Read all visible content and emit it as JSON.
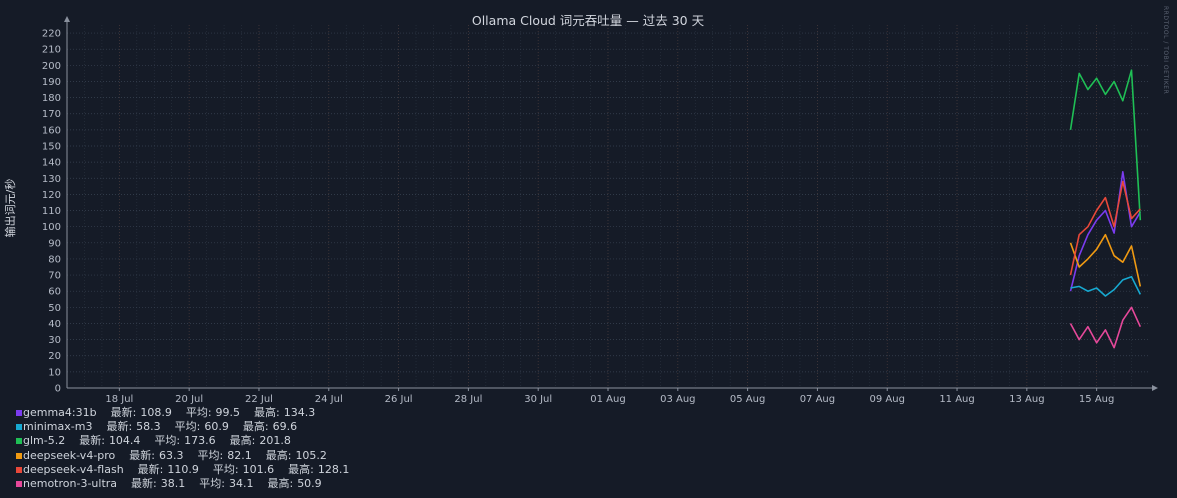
{
  "chart_data": {
    "type": "line",
    "title": "Ollama Cloud 词元吞吐量 — 过去 30 天",
    "ylabel": "输出词元/秒",
    "xlabel": "",
    "ylim": [
      0,
      225
    ],
    "yticks": [
      0,
      10,
      20,
      30,
      40,
      50,
      60,
      70,
      80,
      90,
      100,
      110,
      120,
      130,
      140,
      150,
      160,
      170,
      180,
      190,
      200,
      210,
      220
    ],
    "xlim": [
      "2025-07-16T12:00",
      "2025-08-16T12:00"
    ],
    "xticks": [
      {
        "date": "2025-07-18",
        "label": "18 Jul"
      },
      {
        "date": "2025-07-20",
        "label": "20 Jul"
      },
      {
        "date": "2025-07-22",
        "label": "22 Jul"
      },
      {
        "date": "2025-07-24",
        "label": "24 Jul"
      },
      {
        "date": "2025-07-26",
        "label": "26 Jul"
      },
      {
        "date": "2025-07-28",
        "label": "28 Jul"
      },
      {
        "date": "2025-07-30",
        "label": "30 Jul"
      },
      {
        "date": "2025-08-01",
        "label": "01 Aug"
      },
      {
        "date": "2025-08-03",
        "label": "03 Aug"
      },
      {
        "date": "2025-08-05",
        "label": "05 Aug"
      },
      {
        "date": "2025-08-07",
        "label": "07 Aug"
      },
      {
        "date": "2025-08-09",
        "label": "09 Aug"
      },
      {
        "date": "2025-08-11",
        "label": "11 Aug"
      },
      {
        "date": "2025-08-13",
        "label": "13 Aug"
      },
      {
        "date": "2025-08-15",
        "label": "15 Aug"
      }
    ],
    "grid": true,
    "legend_position": "bottom-left",
    "stat_labels": {
      "latest": "最新:",
      "avg": "平均:",
      "max": "最高:"
    },
    "series": [
      {
        "name": "gemma4:31b",
        "color": "#7b3cf0",
        "latest": "108.9",
        "avg": "99.5",
        "max": "134.3",
        "x": [
          "2025-08-14T06:00",
          "2025-08-14T12:00",
          "2025-08-14T18:00",
          "2025-08-15T00:00",
          "2025-08-15T06:00",
          "2025-08-15T12:00",
          "2025-08-15T18:00",
          "2025-08-16T00:00",
          "2025-08-16T06:00"
        ],
        "y": [
          60,
          82,
          95,
          104,
          110,
          96,
          134,
          100,
          109
        ]
      },
      {
        "name": "minimax-m3",
        "color": "#17a9d1",
        "latest": "58.3",
        "avg": "60.9",
        "max": "69.6",
        "x": [
          "2025-08-14T06:00",
          "2025-08-14T12:00",
          "2025-08-14T18:00",
          "2025-08-15T00:00",
          "2025-08-15T06:00",
          "2025-08-15T12:00",
          "2025-08-15T18:00",
          "2025-08-16T00:00",
          "2025-08-16T06:00"
        ],
        "y": [
          62,
          63,
          60,
          62,
          57,
          61,
          67,
          69,
          58
        ]
      },
      {
        "name": "glm-5.2",
        "color": "#1fbf55",
        "latest": "104.4",
        "avg": "173.6",
        "max": "201.8",
        "x": [
          "2025-08-14T06:00",
          "2025-08-14T12:00",
          "2025-08-14T18:00",
          "2025-08-15T00:00",
          "2025-08-15T06:00",
          "2025-08-15T12:00",
          "2025-08-15T18:00",
          "2025-08-16T00:00",
          "2025-08-16T06:00"
        ],
        "y": [
          160,
          195,
          185,
          192,
          182,
          190,
          178,
          197,
          104
        ]
      },
      {
        "name": "deepseek-v4-pro",
        "color": "#f09a12",
        "latest": "63.3",
        "avg": "82.1",
        "max": "105.2",
        "x": [
          "2025-08-14T06:00",
          "2025-08-14T12:00",
          "2025-08-14T18:00",
          "2025-08-15T00:00",
          "2025-08-15T06:00",
          "2025-08-15T12:00",
          "2025-08-15T18:00",
          "2025-08-16T00:00",
          "2025-08-16T06:00"
        ],
        "y": [
          90,
          75,
          80,
          86,
          95,
          82,
          78,
          88,
          63
        ]
      },
      {
        "name": "deepseek-v4-flash",
        "color": "#e8483a",
        "latest": "110.9",
        "avg": "101.6",
        "max": "128.1",
        "x": [
          "2025-08-14T06:00",
          "2025-08-14T12:00",
          "2025-08-14T18:00",
          "2025-08-15T00:00",
          "2025-08-15T06:00",
          "2025-08-15T12:00",
          "2025-08-15T18:00",
          "2025-08-16T00:00",
          "2025-08-16T06:00"
        ],
        "y": [
          70,
          95,
          100,
          110,
          118,
          100,
          128,
          105,
          111
        ]
      },
      {
        "name": "nemotron-3-ultra",
        "color": "#e6489a",
        "latest": "38.1",
        "avg": "34.1",
        "max": "50.9",
        "x": [
          "2025-08-14T06:00",
          "2025-08-14T12:00",
          "2025-08-14T18:00",
          "2025-08-15T00:00",
          "2025-08-15T06:00",
          "2025-08-15T12:00",
          "2025-08-15T18:00",
          "2025-08-16T00:00",
          "2025-08-16T06:00"
        ],
        "y": [
          40,
          30,
          38,
          28,
          36,
          25,
          42,
          50,
          38
        ]
      }
    ]
  },
  "watermark": "RRDTOOL / TOBI OETIKER"
}
